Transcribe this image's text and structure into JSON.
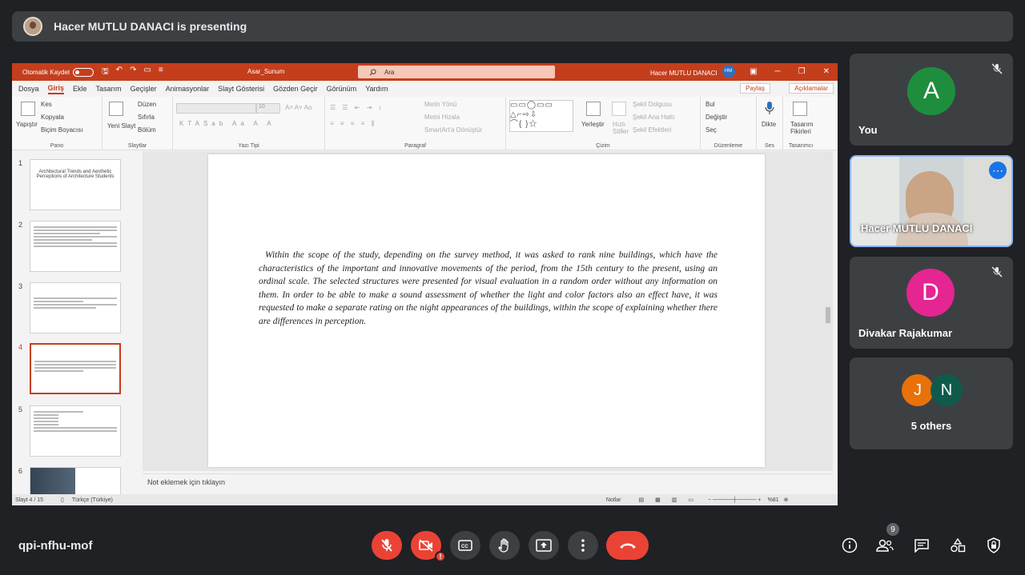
{
  "topbar": {
    "presenting_text": "Hacer MUTLU DANACI is presenting"
  },
  "ppt": {
    "autosave_label": "Otomatik Kaydet",
    "filename": "Asar_Sunum",
    "search_placeholder": "Ara",
    "user_name": "Hacer MUTLU DANACI",
    "user_initials": "HM",
    "menu": [
      "Dosya",
      "Giriş",
      "Ekle",
      "Tasarım",
      "Geçişler",
      "Animasyonlar",
      "Slayt Gösterisi",
      "Gözden Geçir",
      "Görünüm",
      "Yardım"
    ],
    "share_label": "Paylaş",
    "comments_label": "Açıklamalar",
    "ribbon": {
      "pano": {
        "label": "Pano",
        "paste": "Yapıştır",
        "cut": "Kes",
        "copy": "Kopyala",
        "format_painter": "Biçim Boyacısı"
      },
      "slaytlar": {
        "label": "Slaytlar",
        "new_slide": "Yeni Slayt",
        "layout": "Düzen",
        "reset": "Sıfırla",
        "section": "Bölüm"
      },
      "yazitipi": {
        "label": "Yazı Tipi",
        "size": "10"
      },
      "paragraf": {
        "label": "Paragraf",
        "text_dir": "Metin Yönü",
        "align_text": "Metni Hizala",
        "smartart": "SmartArt'a Dönüştür"
      },
      "cizim": {
        "label": "Çizim",
        "arrange": "Yerleştir",
        "quick_styles": "Hızlı Stiller",
        "fill": "Şekil Dolgusu",
        "outline": "Şekil Ana Hattı",
        "effects": "Şekil Efektleri"
      },
      "duzenleme": {
        "label": "Düzenleme",
        "find": "Bul",
        "replace": "Değiştir",
        "select": "Seç"
      },
      "ses": {
        "label": "Ses",
        "dictate": "Dikte"
      },
      "tasarimci": {
        "label": "Tasarımcı",
        "design_ideas": "Tasarım Fikirleri"
      }
    },
    "thumbnails": [
      {
        "num": "1",
        "title": "Architectural Trends and Aesthetic Perceptions of Architecture Students"
      },
      {
        "num": "2"
      },
      {
        "num": "3"
      },
      {
        "num": "4"
      },
      {
        "num": "5"
      },
      {
        "num": "6"
      }
    ],
    "slide_text": "Within the scope of the study, depending on the survey method, it was asked to rank nine buildings, which have the characteristics of the important and innovative movements of the period, from the 15th century to the present, using an ordinal scale. The selected structures were presented for visual evaluation in a random order without any information on them. In order to be able to make a sound assessment of whether the light and color factors also an effect have, it was requested to make a separate rating on the night appearances of the buildings, within the scope of explaining whether there are differences in perception.",
    "notes_placeholder": "Not eklemek için tıklayın",
    "status": {
      "slide": "Slayt 4 / 15",
      "language": "Türkçe (Türkiye)",
      "notes": "Notlar",
      "zoom": "%81"
    }
  },
  "participants": [
    {
      "name": "You",
      "initial": "A",
      "color": "#1e8e3e"
    },
    {
      "name": "Hacer MUTLU DANACI"
    },
    {
      "name": "Divakar Rajakumar",
      "initial": "D",
      "color": "#e52592"
    },
    {
      "name": "5 others",
      "initials": [
        "J",
        "N"
      ],
      "colors": [
        "#e8710a",
        "#0f5b4b"
      ]
    }
  ],
  "meeting": {
    "code": "qpi-nfhu-mof",
    "people_count": "9"
  },
  "colors": {
    "end_call": "#ea4335",
    "ppt_accent": "#c43e1c"
  }
}
